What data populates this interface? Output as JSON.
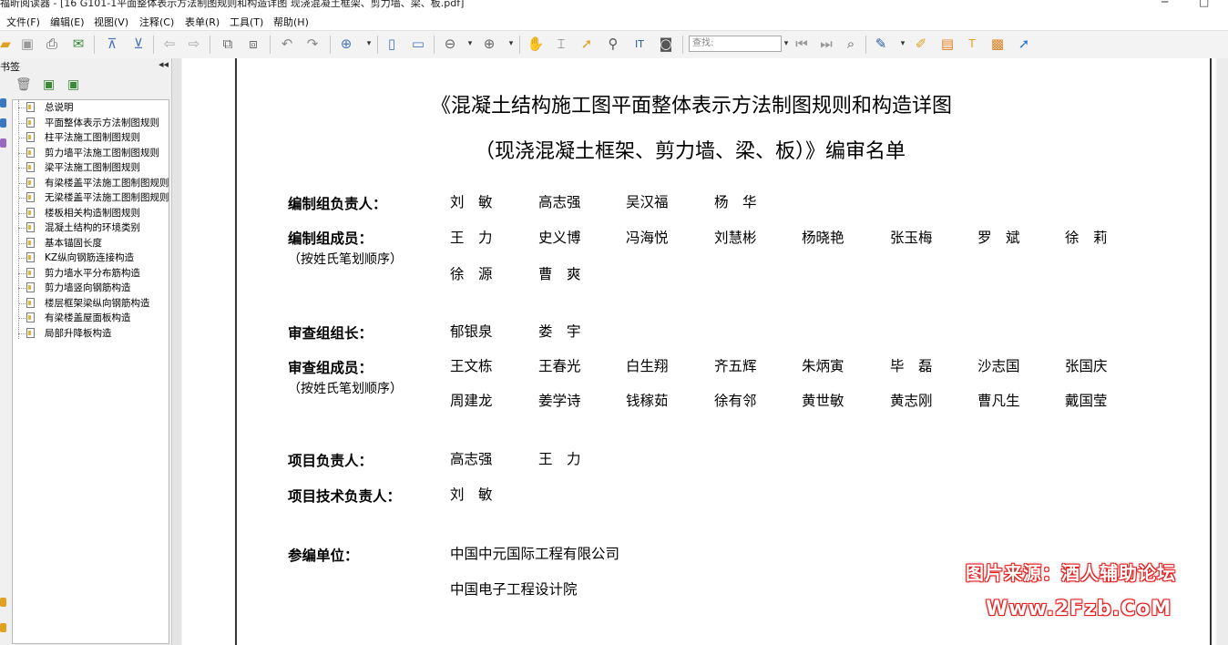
{
  "window": {
    "title": "福昕阅读器 - [16 G101-1平面整体表示方法制图规则和构造详图 现浇混凝土框架、剪力墙、梁、板.pdf]",
    "minimize": "─",
    "restore": "□"
  },
  "menu": [
    "文件(F)",
    "编辑(E)",
    "视图(V)",
    "注释(C)",
    "表单(R)",
    "工具(T)",
    "帮助(H)"
  ],
  "toolbar": {
    "search_placeholder": "查找:"
  },
  "left_panel": {
    "header": "书签",
    "collapse": "◂◂",
    "bookmarks": [
      "总说明",
      "平面整体表示方法制图规则",
      "柱平法施工图制图规则",
      "剪力墙平法施工图制图规则",
      "梁平法施工图制图规则",
      "有梁楼盖平法施工图制图规则",
      "无梁楼盖平法施工图制图规则",
      "楼板相关构造制图规则",
      "混凝土结构的环境类别",
      "基本锚固长度",
      "KZ纵向钢筋连接构造",
      "剪力墙水平分布筋构造",
      "剪力墙竖向钢筋构造",
      "楼层框架梁纵向钢筋构造",
      "有梁楼盖屋面板构造",
      "局部升降板构造"
    ]
  },
  "document": {
    "title_line1": "《混凝土结构施工图平面整体表示方法制图规则和构造详图",
    "title_line2": "（现浇混凝土框架、剪力墙、梁、板）》编审名单",
    "sections": {
      "editor_lead": {
        "label": "编制组负责人：",
        "names": [
          "刘　敏",
          "高志强",
          "吴汉福",
          "杨　华"
        ]
      },
      "editor_members": {
        "label": "编制组成员：",
        "note": "（按姓氏笔划顺序）",
        "row1": [
          "王　力",
          "史义博",
          "冯海悦",
          "刘慧彬",
          "杨晓艳",
          "张玉梅",
          "罗　斌",
          "徐　莉"
        ],
        "row2": [
          "徐　源",
          "曹　爽"
        ]
      },
      "review_lead": {
        "label": "审查组组长：",
        "names": [
          "郁银泉",
          "娄　宇"
        ]
      },
      "review_members": {
        "label": "审查组成员：",
        "note": "（按姓氏笔划顺序）",
        "row1": [
          "王文栋",
          "王春光",
          "白生翔",
          "齐五辉",
          "朱炳寅",
          "毕　磊",
          "沙志国",
          "张国庆"
        ],
        "row2": [
          "周建龙",
          "姜学诗",
          "钱稼茹",
          "徐有邻",
          "黄世敏",
          "黄志刚",
          "曹凡生",
          "戴国莹"
        ]
      },
      "project_lead": {
        "label": "项目负责人：",
        "names": [
          "高志强",
          "王　力"
        ]
      },
      "tech_lead": {
        "label": "项目技术负责人：",
        "names": [
          "刘　敏"
        ]
      },
      "units": {
        "label": "参编单位：",
        "names": [
          "中国中元国际工程有限公司",
          "中国电子工程设计院"
        ]
      }
    }
  },
  "watermark": {
    "line1": "图片来源：酒人辅助论坛",
    "line2": "Www.2Fzb.CoM"
  }
}
